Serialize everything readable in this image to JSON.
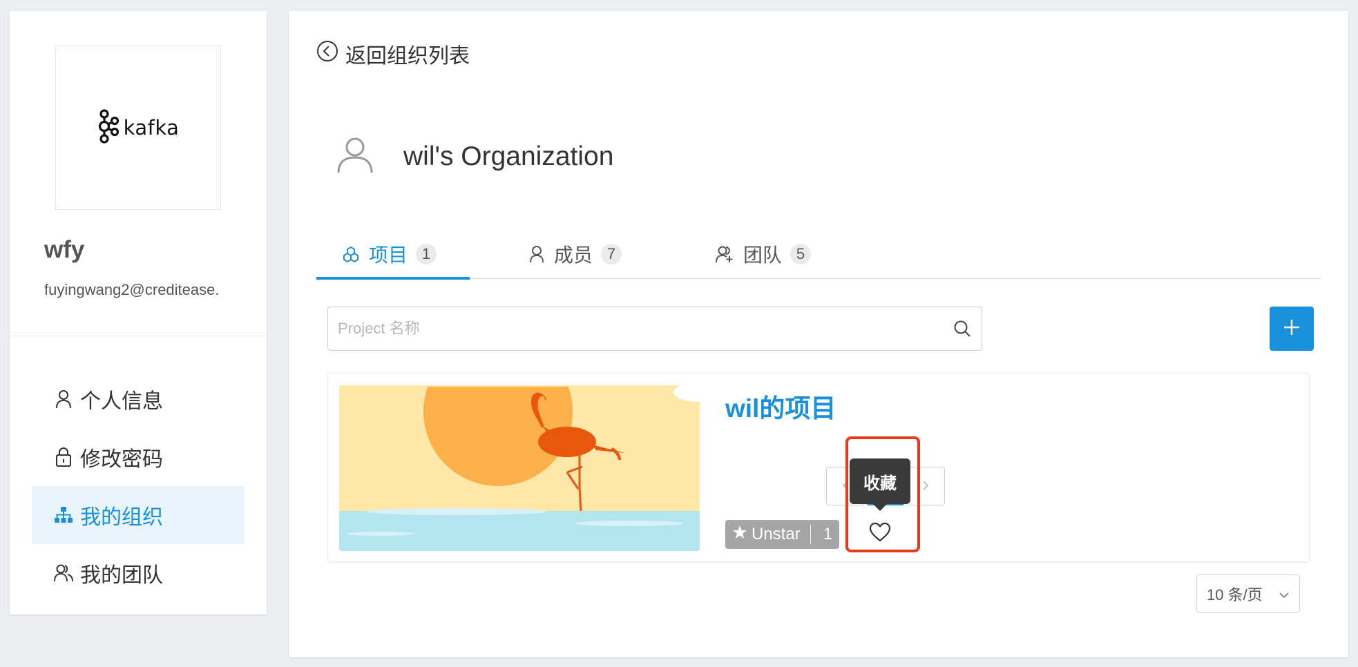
{
  "sidebar": {
    "logo_text": "kafka",
    "user_name": "wfy",
    "user_email": "fuyingwang2@creditease.",
    "menu": [
      {
        "label": "个人信息",
        "icon": "user-icon"
      },
      {
        "label": "修改密码",
        "icon": "lock-icon"
      },
      {
        "label": "我的组织",
        "icon": "org-tree-icon",
        "active": true
      },
      {
        "label": "我的团队",
        "icon": "team-icon"
      }
    ]
  },
  "main": {
    "back_label": "返回组织列表",
    "org_name": "wil's Organization",
    "tabs": [
      {
        "label": "项目",
        "count": "1",
        "icon": "project-icon",
        "active": true
      },
      {
        "label": "成员",
        "count": "7",
        "icon": "member-icon"
      },
      {
        "label": "团队",
        "count": "5",
        "icon": "team-add-icon"
      }
    ],
    "search": {
      "placeholder": "Project 名称",
      "value": ""
    },
    "project": {
      "title": "wil的项目",
      "star_label": "Unstar",
      "star_count": "1",
      "tooltip": "收藏"
    },
    "pagination": {
      "current_page": "1",
      "page_size": "10 条/页"
    }
  },
  "colors": {
    "accent": "#1890db",
    "highlight": "#e8391a",
    "active_menu_bg": "#e9f4fc"
  }
}
